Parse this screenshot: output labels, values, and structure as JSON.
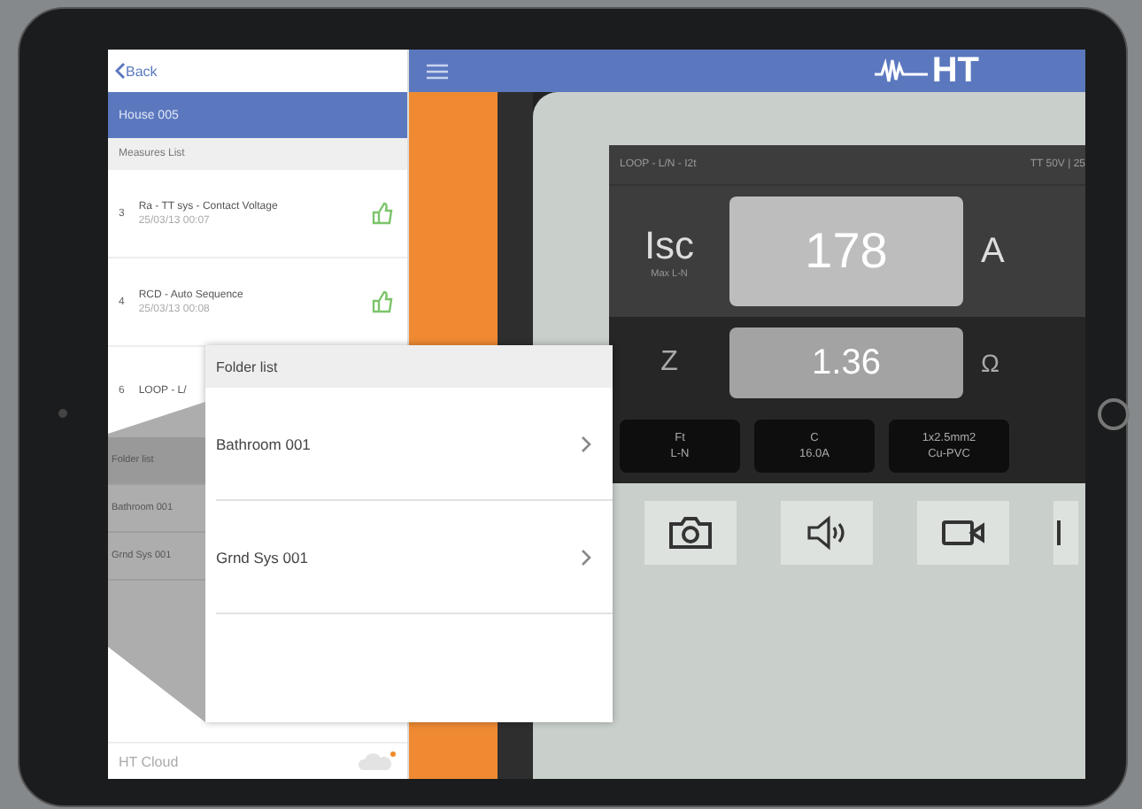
{
  "left_panel": {
    "back": "Back",
    "header": "House  005",
    "section": "Measures List",
    "measures": [
      {
        "index": "3",
        "title": "Ra - TT sys - Contact Voltage",
        "date": "25/03/13 00:07"
      },
      {
        "index": "4",
        "title": "RCD - Auto Sequence",
        "date": "25/03/13 00:08"
      },
      {
        "index": "6",
        "title": "LOOP - L/"
      }
    ],
    "sidebar": [
      {
        "label": "Folder list",
        "selected": true
      },
      {
        "label": "Bathroom 001",
        "selected": false
      },
      {
        "label": "Grnd Sys  001",
        "selected": false
      }
    ],
    "footer": "HT Cloud"
  },
  "popover": {
    "title": "Folder list",
    "items": [
      "Bathroom 001",
      "Grnd Sys  001"
    ]
  },
  "top_bar": {
    "logo": "HT"
  },
  "meter": {
    "title": "LOOP - L/N - I2t",
    "settings": "TT 50V | 25",
    "results": [
      {
        "label": "Isc",
        "sublabel": "Max L-N",
        "value": "178",
        "unit": "A"
      },
      {
        "label": "Z",
        "value": "1.36",
        "unit": "Ω"
      }
    ],
    "chips": [
      {
        "top": "Ft",
        "bottom": "L-N"
      },
      {
        "top": "C",
        "bottom": "16.0A"
      },
      {
        "top": "1x2.5mm2",
        "bottom": "Cu-PVC"
      }
    ],
    "tools": [
      {
        "kind": "camera"
      },
      {
        "kind": "speaker"
      },
      {
        "kind": "video"
      },
      {
        "kind": "partial"
      }
    ]
  }
}
